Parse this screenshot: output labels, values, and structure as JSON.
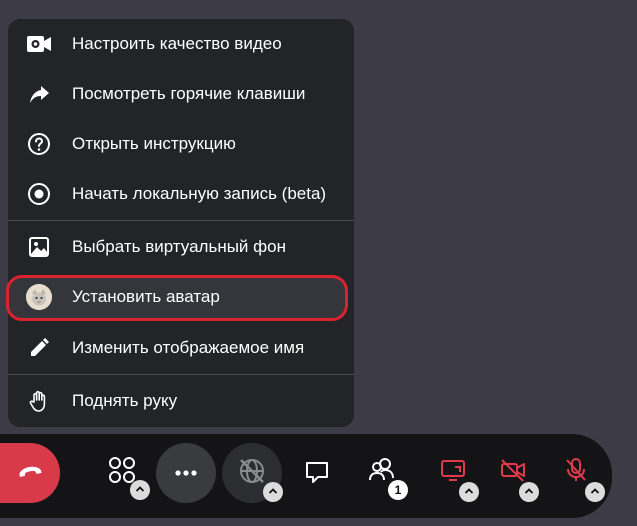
{
  "menu": {
    "items": [
      {
        "label": "Настроить качество видео",
        "icon": "video-settings-icon"
      },
      {
        "label": "Посмотреть горячие клавиши",
        "icon": "share-arrow-icon"
      },
      {
        "label": "Открыть инструкцию",
        "icon": "help-circle-icon"
      },
      {
        "label": "Начать локальную запись (beta)",
        "icon": "record-icon"
      },
      {
        "label": "Выбрать виртуальный фон",
        "icon": "image-icon"
      },
      {
        "label": "Установить аватар",
        "icon": "avatar-icon",
        "selected": true
      },
      {
        "label": "Изменить отображаемое имя",
        "icon": "pencil-icon"
      },
      {
        "label": "Поднять руку",
        "icon": "hand-icon"
      }
    ]
  },
  "toolbar": {
    "participants_count": "1",
    "colors": {
      "end_call": "#d83a4a",
      "muted": "#e03a4c",
      "highlight_border": "#d9232f",
      "menu_bg": "#232428",
      "toolbar_bg": "#141416"
    }
  }
}
